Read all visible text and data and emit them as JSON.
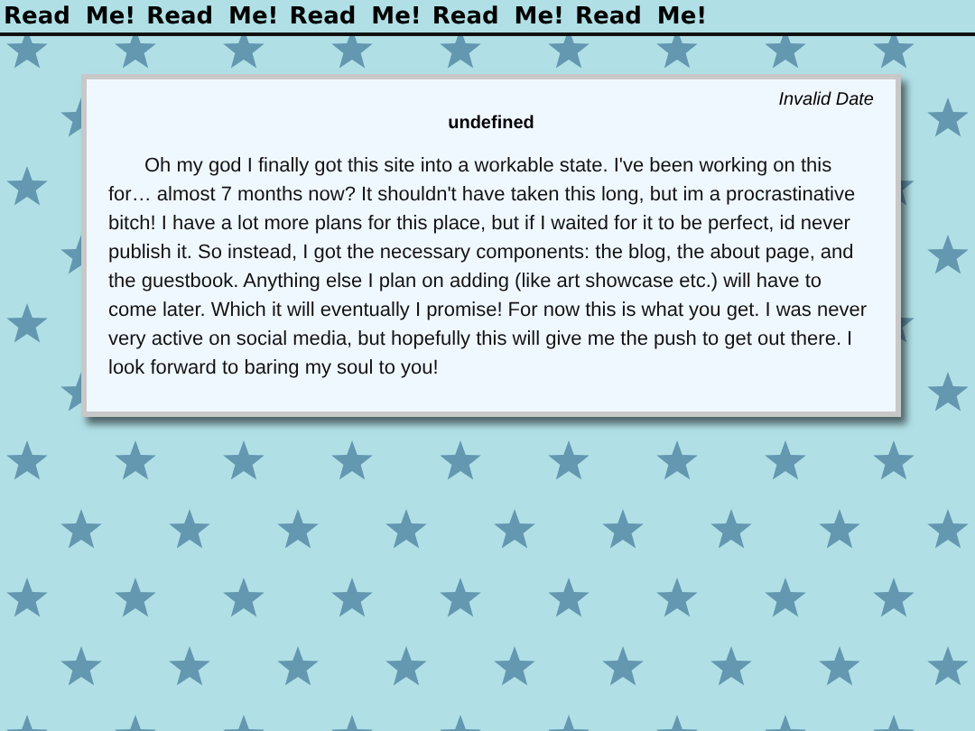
{
  "marquee": {
    "items": [
      "Read Me!",
      "Read Me!",
      "Read Me!",
      "Read Me!",
      "Read Me!"
    ]
  },
  "post": {
    "date": "Invalid Date",
    "title": "undefined",
    "body": "Oh my god I finally got this site into a workable state. I've been working on this for… almost 7 months now? It shouldn't have taken this long, but im a procrastinative bitch! I have a lot more plans for this place, but if I waited for it to be perfect, id never publish it. So instead, I got the necessary components: the blog, the about page, and the guestbook. Anything else I plan on adding (like art showcase etc.) will have to come later. Which it will eventually I promise! For now this is what you get. I was never very active on social media, but hopefully this will give me the push to get out there. I look forward to baring my soul to you!"
  }
}
